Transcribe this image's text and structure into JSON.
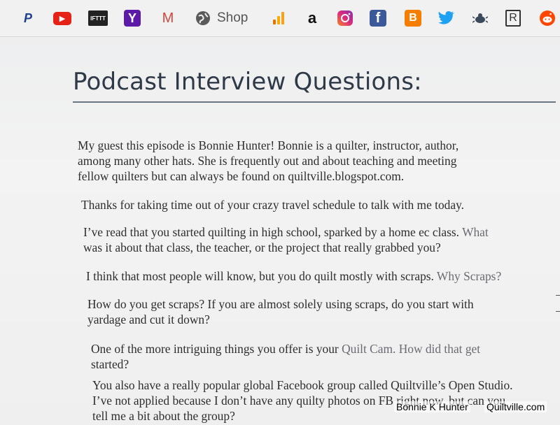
{
  "bookmarks": {
    "shop_label": "Shop",
    "items": [
      {
        "name": "paypal-icon",
        "glyph": "P",
        "color": "#1f3f8f"
      },
      {
        "name": "youtube-icon",
        "glyph": "▶",
        "color": "#e62117"
      },
      {
        "name": "ifttt-icon",
        "glyph": "IFTTT",
        "color": "#222222"
      },
      {
        "name": "yahoo-icon",
        "glyph": "Y",
        "color": "#5b1aa8"
      },
      {
        "name": "gmail-icon",
        "glyph": "M",
        "color": "#d44638"
      },
      {
        "name": "shop-globe-icon",
        "glyph": "",
        "color": "#5a5a5a"
      },
      {
        "name": "analytics-icon",
        "glyph": "",
        "color": "#f4a11d"
      },
      {
        "name": "amazon-icon",
        "glyph": "a",
        "color": "#111111"
      },
      {
        "name": "instagram-icon",
        "glyph": "◎",
        "color": "#d1307a"
      },
      {
        "name": "facebook-icon",
        "glyph": "f",
        "color": "#3b5998"
      },
      {
        "name": "blogger-icon",
        "glyph": "B",
        "color": "#f57d00"
      },
      {
        "name": "twitter-icon",
        "glyph": "🐦",
        "color": "#1da1f2"
      },
      {
        "name": "bug-icon",
        "glyph": "",
        "color": "#3a4a5a"
      },
      {
        "name": "r-icon",
        "glyph": "R",
        "color": "#333333"
      },
      {
        "name": "reddit-icon",
        "glyph": "",
        "color": "#ff4500"
      }
    ]
  },
  "document": {
    "title": "Podcast Interview Questions:",
    "p1_l1": "My guest this episode is Bonnie Hunter! Bonnie is a quilter, instructor, author,",
    "p1_l2": "among many other hats. She is frequently out and about teaching and meeting",
    "p1_l3": "fellow quilters but can always be found on quiltville.blogspot.com.",
    "p2_l1": "Thanks for taking time out of your crazy travel schedule to talk with me today.",
    "p3_l1a": "I’ve read that you started quilting in high school, sparked by a home ec class.",
    "p3_l1b": " What",
    "p3_l2": "was it about that class, the teacher, or the project that really grabbed you?",
    "p4_l1a": "I think that most people will know, but you do quilt mostly with scraps.",
    "p4_l1b": " Why Scraps?",
    "p5_l1": "How do you get scraps? If you are almost solely using scraps, do you start with",
    "p5_l2": "yardage and cut it down?",
    "p6_l1a": "One of the more intriguing things you offer is your",
    "p6_l1b": " Quilt Cam. How did that get",
    "p6_l2": "started?",
    "p7_l1": "You also have a really popular global Facebook group called Quiltville’s Open Studio.",
    "p7_l2": "I’ve not applied because I don’t have any quilty photos on FB right now, but can you",
    "p7_l3": "tell me a bit about the group?"
  },
  "watermark": {
    "author": "Bonnie K Hunter",
    "site": "Quiltville.com"
  }
}
